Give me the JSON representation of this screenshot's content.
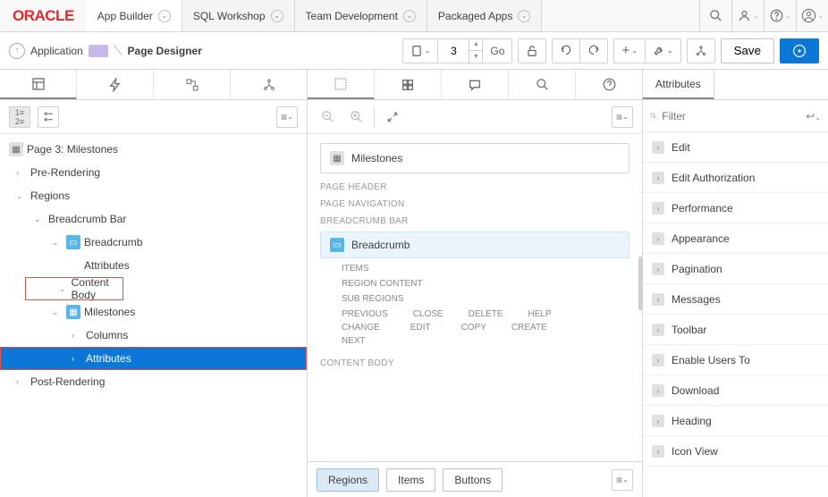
{
  "header": {
    "logo": "ORACLE",
    "tabs": [
      "App Builder",
      "SQL Workshop",
      "Team Development",
      "Packaged Apps"
    ],
    "active_tab": 0
  },
  "toolbar": {
    "crumb_app": "Application",
    "crumb_page": "Page Designer",
    "page_number": "3",
    "go": "Go",
    "save": "Save"
  },
  "left": {
    "page_title": "Page 3: Milestones",
    "tree": {
      "pre_rendering": "Pre-Rendering",
      "regions": "Regions",
      "breadcrumb_bar": "Breadcrumb Bar",
      "breadcrumb": "Breadcrumb",
      "bc_attributes": "Attributes",
      "content_body": "Content Body",
      "milestones": "Milestones",
      "columns": "Columns",
      "attributes": "Attributes",
      "post_rendering": "Post-Rendering"
    }
  },
  "center": {
    "milestones": "Milestones",
    "sections": {
      "page_header": "PAGE HEADER",
      "page_nav": "PAGE NAVIGATION",
      "breadcrumb_bar": "BREADCRUMB BAR",
      "breadcrumb": "Breadcrumb",
      "items": "ITEMS",
      "region_content": "REGION CONTENT",
      "sub_regions": "SUB REGIONS",
      "content_body": "CONTENT BODY"
    },
    "actions": {
      "previous": "PREVIOUS",
      "close": "CLOSE",
      "delete": "DELETE",
      "help": "HELP",
      "change": "CHANGE",
      "edit": "EDIT",
      "copy": "COPY",
      "create": "CREATE",
      "next": "NEXT"
    },
    "footer_tabs": {
      "regions": "Regions",
      "items": "Items",
      "buttons": "Buttons"
    }
  },
  "right": {
    "title": "Attributes",
    "filter_placeholder": "Filter",
    "groups": [
      "Edit",
      "Edit Authorization",
      "Performance",
      "Appearance",
      "Pagination",
      "Messages",
      "Toolbar",
      "Enable Users To",
      "Download",
      "Heading",
      "Icon View"
    ]
  }
}
